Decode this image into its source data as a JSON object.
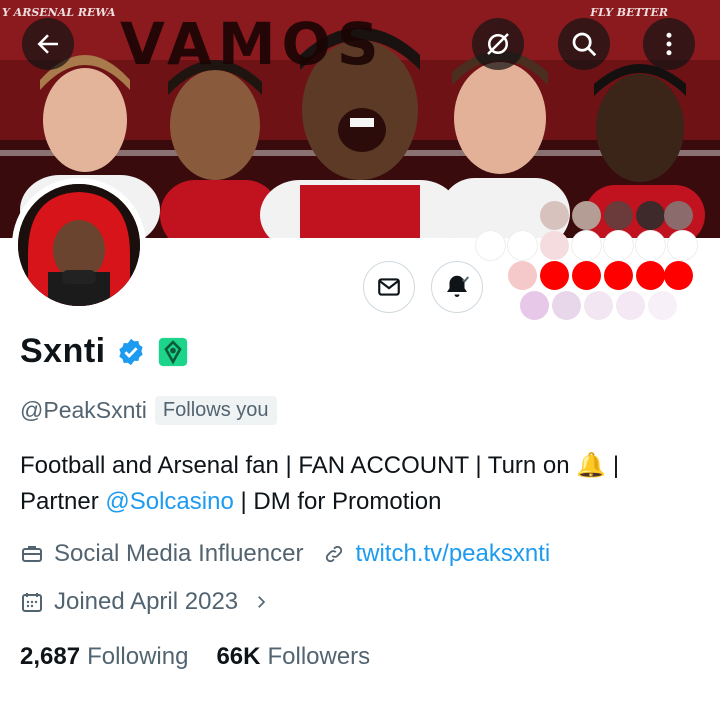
{
  "banner": {
    "left_text": "Y ARSENAL REWA",
    "big_text": "VAMOS",
    "right_text": "FLY BETTER"
  },
  "top_icons": {
    "back": "arrow-left-icon",
    "translate": "translate-off-icon",
    "search": "search-icon",
    "more": "more-vertical-icon"
  },
  "profile": {
    "name": "Sxnti",
    "handle": "@PeakSxnti",
    "follows_you": "Follows you",
    "bio_line1": "Football and Arsenal fan | FAN ACCOUNT | Turn on 🔔 |",
    "bio_line2_prefix": "Partner ",
    "bio_mention": "@Solcasino",
    "bio_line2_suffix": " | DM for Promotion",
    "category": "Social Media Influencer",
    "website": "twitch.tv/peaksxnti",
    "joined": "Joined April 2023",
    "following_count": "2,687",
    "following_label": "Following",
    "followers_count": "66K",
    "followers_label": "Followers"
  },
  "colors": {
    "link": "#1d9bf0",
    "verified": "#1d9bf0",
    "affiliate": "#1dd48b",
    "secondary_text": "#536471"
  }
}
